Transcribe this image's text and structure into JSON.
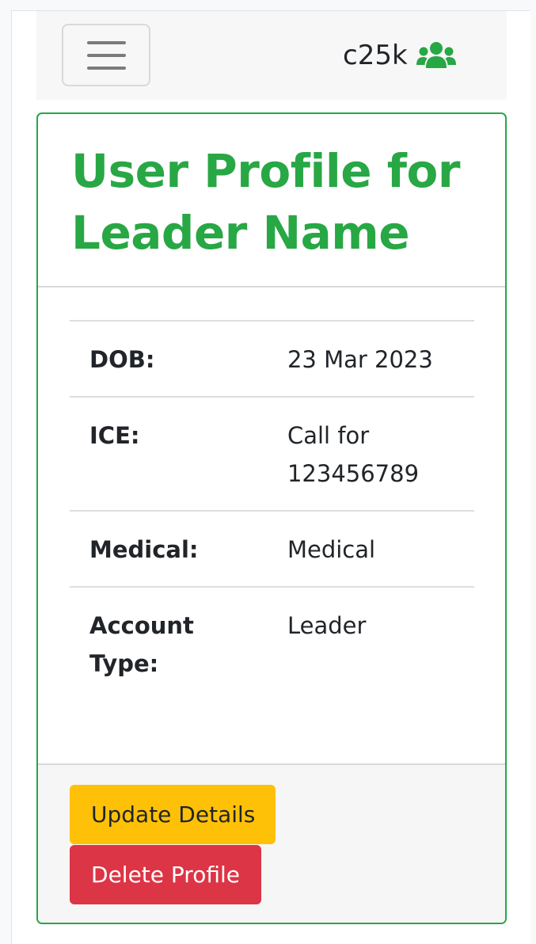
{
  "navbar": {
    "toggler_icon": "hamburger-icon",
    "brand_text": "c25k",
    "brand_icon": "users-icon",
    "brand_icon_color": "#28a745"
  },
  "profile": {
    "title": "User Profile for Leader Name",
    "rows": [
      {
        "label": "DOB:",
        "value": "23 Mar 2023"
      },
      {
        "label": "ICE:",
        "value": "Call for 123456789"
      },
      {
        "label": "Medical:",
        "value": "Medical"
      },
      {
        "label": "Account Type:",
        "value": "Leader"
      }
    ]
  },
  "actions": {
    "update_label": "Update Details",
    "delete_label": "Delete Profile"
  },
  "colors": {
    "accent": "#28a745",
    "warning": "#ffc107",
    "danger": "#dc3545"
  }
}
